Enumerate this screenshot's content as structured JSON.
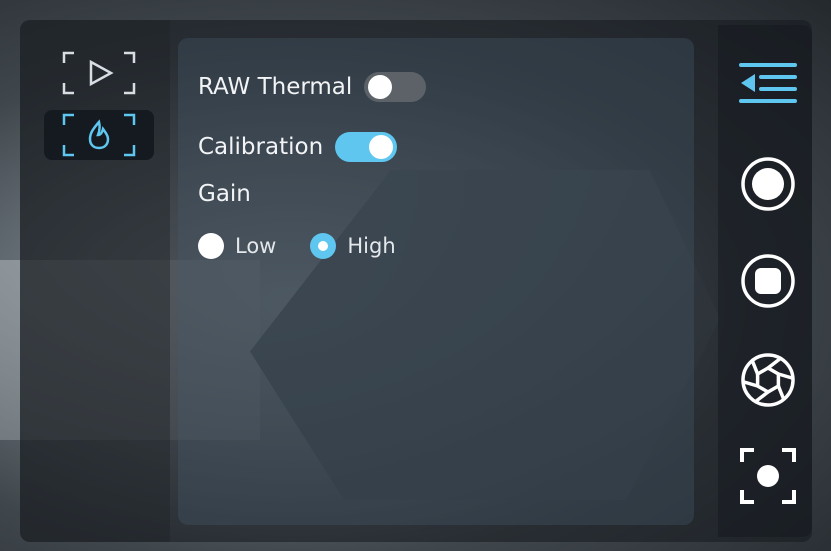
{
  "colors": {
    "accent": "#5fc6f0",
    "toggle_off": "#5c6268",
    "text": "#f2f4f6",
    "icon": "#ffffff"
  },
  "mode_bar": {
    "items": [
      {
        "icon": "video-play-icon",
        "active": false
      },
      {
        "icon": "thermal-flame-icon",
        "active": true
      }
    ]
  },
  "settings": {
    "raw_thermal": {
      "label": "RAW Thermal",
      "enabled": false
    },
    "calibration": {
      "label": "Calibration",
      "enabled": true
    },
    "gain": {
      "label": "Gain",
      "options": [
        {
          "label": "Low",
          "selected": false
        },
        {
          "label": "High",
          "selected": true
        }
      ]
    }
  },
  "toolbar": {
    "items": [
      {
        "icon": "menu-collapse-icon"
      },
      {
        "icon": "record-icon"
      },
      {
        "icon": "stop-icon"
      },
      {
        "icon": "aperture-icon"
      },
      {
        "icon": "focus-capture-icon"
      }
    ]
  }
}
